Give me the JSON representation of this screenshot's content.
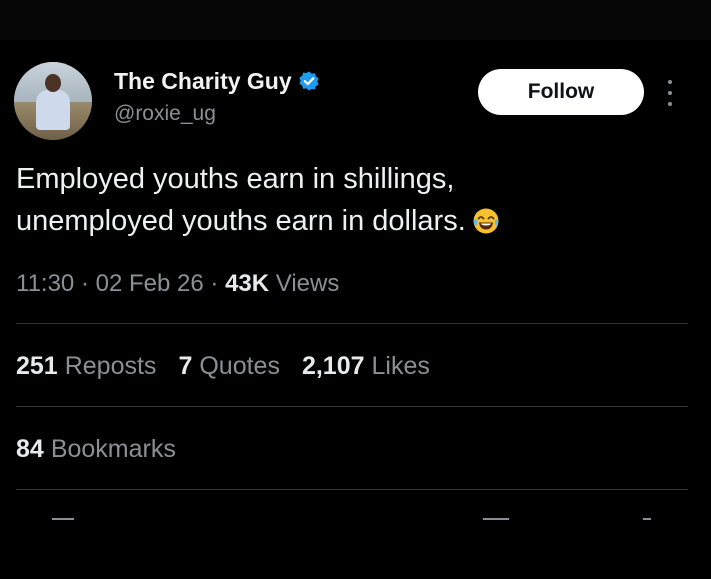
{
  "author": {
    "display_name": "The Charity Guy",
    "handle": "@roxie_ug",
    "verified": true,
    "verified_color": "#1d9bf0"
  },
  "follow_label": "Follow",
  "tweet": {
    "lines": [
      "Employed youths earn in shillings,",
      "unemployed youths earn in dollars."
    ],
    "emoji": "face-with-tears-of-joy"
  },
  "meta": {
    "time": "11:30",
    "date": "02 Feb 26",
    "views_count": "43K",
    "views_label": "Views",
    "separator": "·"
  },
  "stats": [
    {
      "count": "251",
      "label": "Reposts"
    },
    {
      "count": "7",
      "label": "Quotes"
    },
    {
      "count": "2,107",
      "label": "Likes"
    }
  ],
  "bookmarks": {
    "count": "84",
    "label": "Bookmarks"
  },
  "colors": {
    "background": "#000000",
    "text_primary": "#e7e9ea",
    "text_secondary": "#8b9096",
    "divider": "#2f3336",
    "follow_bg": "#ffffff"
  }
}
